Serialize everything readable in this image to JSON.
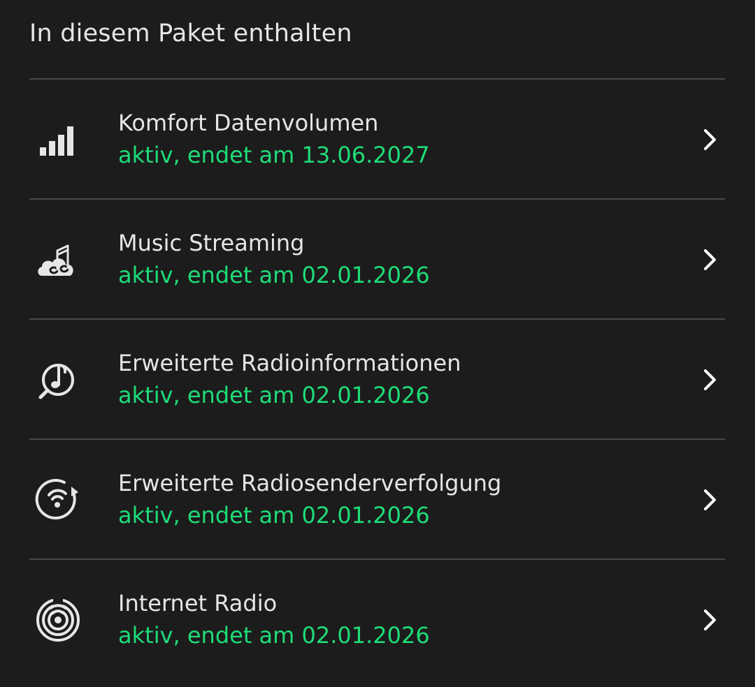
{
  "section": {
    "title": "In diesem Paket enthalten"
  },
  "items": [
    {
      "name": "Komfort Datenvolumen",
      "status": "aktiv, endet am  13.06.2027",
      "icon": "signal-bars-icon"
    },
    {
      "name": "Music Streaming",
      "status": "aktiv, endet am 02.01.2026",
      "icon": "cloud-music-icon"
    },
    {
      "name": "Erweiterte Radioinformationen",
      "status": "aktiv, endet am 02.01.2026",
      "icon": "music-search-icon"
    },
    {
      "name": "Erweiterte Radiosenderverfolgung",
      "status": "aktiv, endet am 02.01.2026",
      "icon": "radio-tracking-icon"
    },
    {
      "name": "Internet Radio",
      "status": "aktiv, endet am 02.01.2026",
      "icon": "internet-radio-icon"
    }
  ],
  "colors": {
    "background": "#1c1c1c",
    "text": "#e6e6e6",
    "status": "#1edc78",
    "divider": "#4a4a4a"
  }
}
